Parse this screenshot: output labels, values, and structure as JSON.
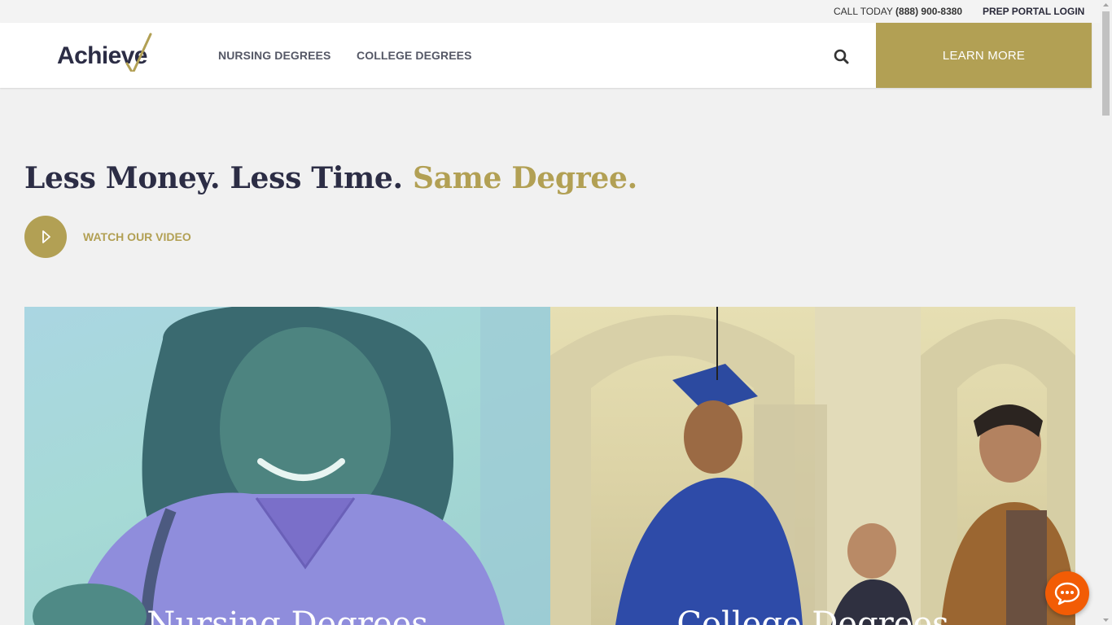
{
  "utility_bar": {
    "call_prefix": "CALL TODAY",
    "phone": "(888) 900-8380",
    "portal_login": "PREP PORTAL LOGIN"
  },
  "header": {
    "logo_text": "Achieve",
    "nav": [
      {
        "label": "NURSING DEGREES"
      },
      {
        "label": "COLLEGE DEGREES"
      }
    ],
    "search_icon": "search-icon",
    "cta_label": "LEARN MORE"
  },
  "hero": {
    "title_part1": "Less Money. Less Time.",
    "title_part2": "Same Degree.",
    "video_label": "WATCH OUR VIDEO"
  },
  "cards": [
    {
      "title": "Nursing Degrees"
    },
    {
      "title": "College Degrees"
    }
  ],
  "colors": {
    "accent": "#b2a054",
    "text_dark": "#2c2d45",
    "background": "#f1f1f1",
    "chat": "#f25c05"
  }
}
